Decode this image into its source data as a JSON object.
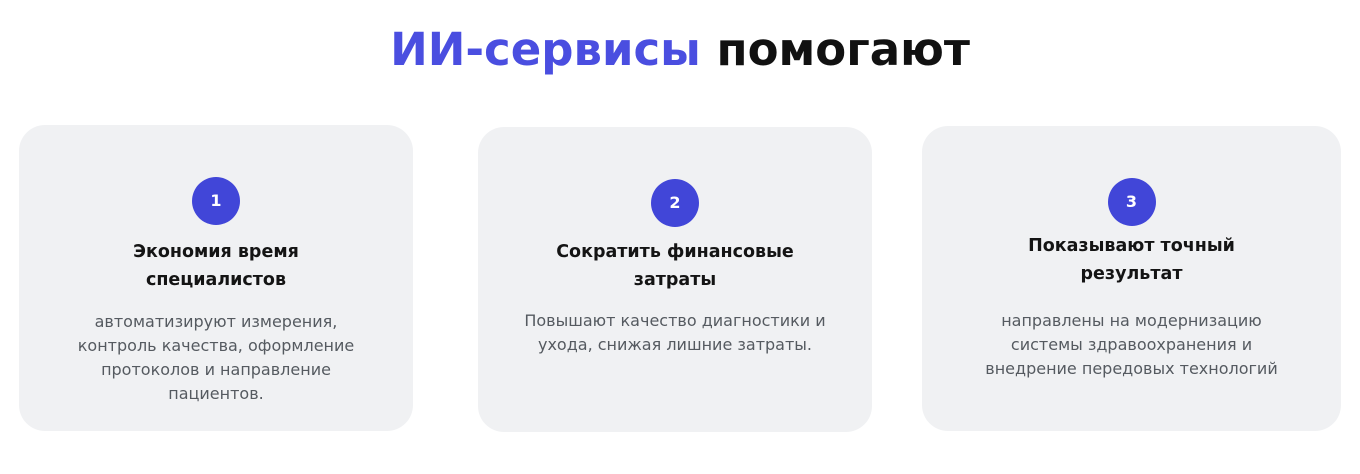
{
  "header": {
    "title_accent": "ИИ-сервисы",
    "title_rest": " помогают"
  },
  "cards": [
    {
      "number": "1",
      "title": "Экономия время специалистов",
      "text": "автоматизируют измерения, контроль качества, оформление протоколов и направление пациентов."
    },
    {
      "number": "2",
      "title": "Сократить финансовые затраты",
      "text": "Повышают качество диагностики и ухода, снижая лишние затраты."
    },
    {
      "number": "3",
      "title": "Показывают точный результат",
      "text": "направлены на модернизацию системы здравоохранения и внедрение передовых технологий"
    }
  ],
  "colors": {
    "accent": "#4a4ee0",
    "badge": "#4146d8",
    "card_background": "#f0f1f3",
    "title_text": "#111111",
    "body_text": "#555a60"
  }
}
